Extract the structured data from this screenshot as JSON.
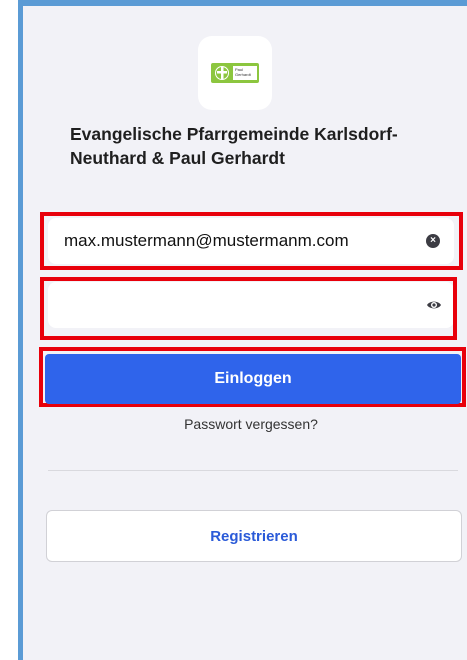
{
  "org": {
    "name": "Evangelische Pfarrgemeinde Karlsdorf-Neuthard & Paul Gerhardt",
    "logo_text": "Paul Gerhardt"
  },
  "login": {
    "email_value": "max.mustermann@mustermanm.com",
    "password_value": "",
    "submit_label": "Einloggen",
    "forgot_label": "Passwort vergessen?"
  },
  "register": {
    "label": "Registrieren"
  },
  "colors": {
    "primary": "#2f64eb",
    "highlight": "#e8000b",
    "frame": "#5b9bd5",
    "logo_green": "#8cc63f"
  },
  "icons": {
    "clear": "clear-circle-icon",
    "eye": "eye-icon"
  }
}
